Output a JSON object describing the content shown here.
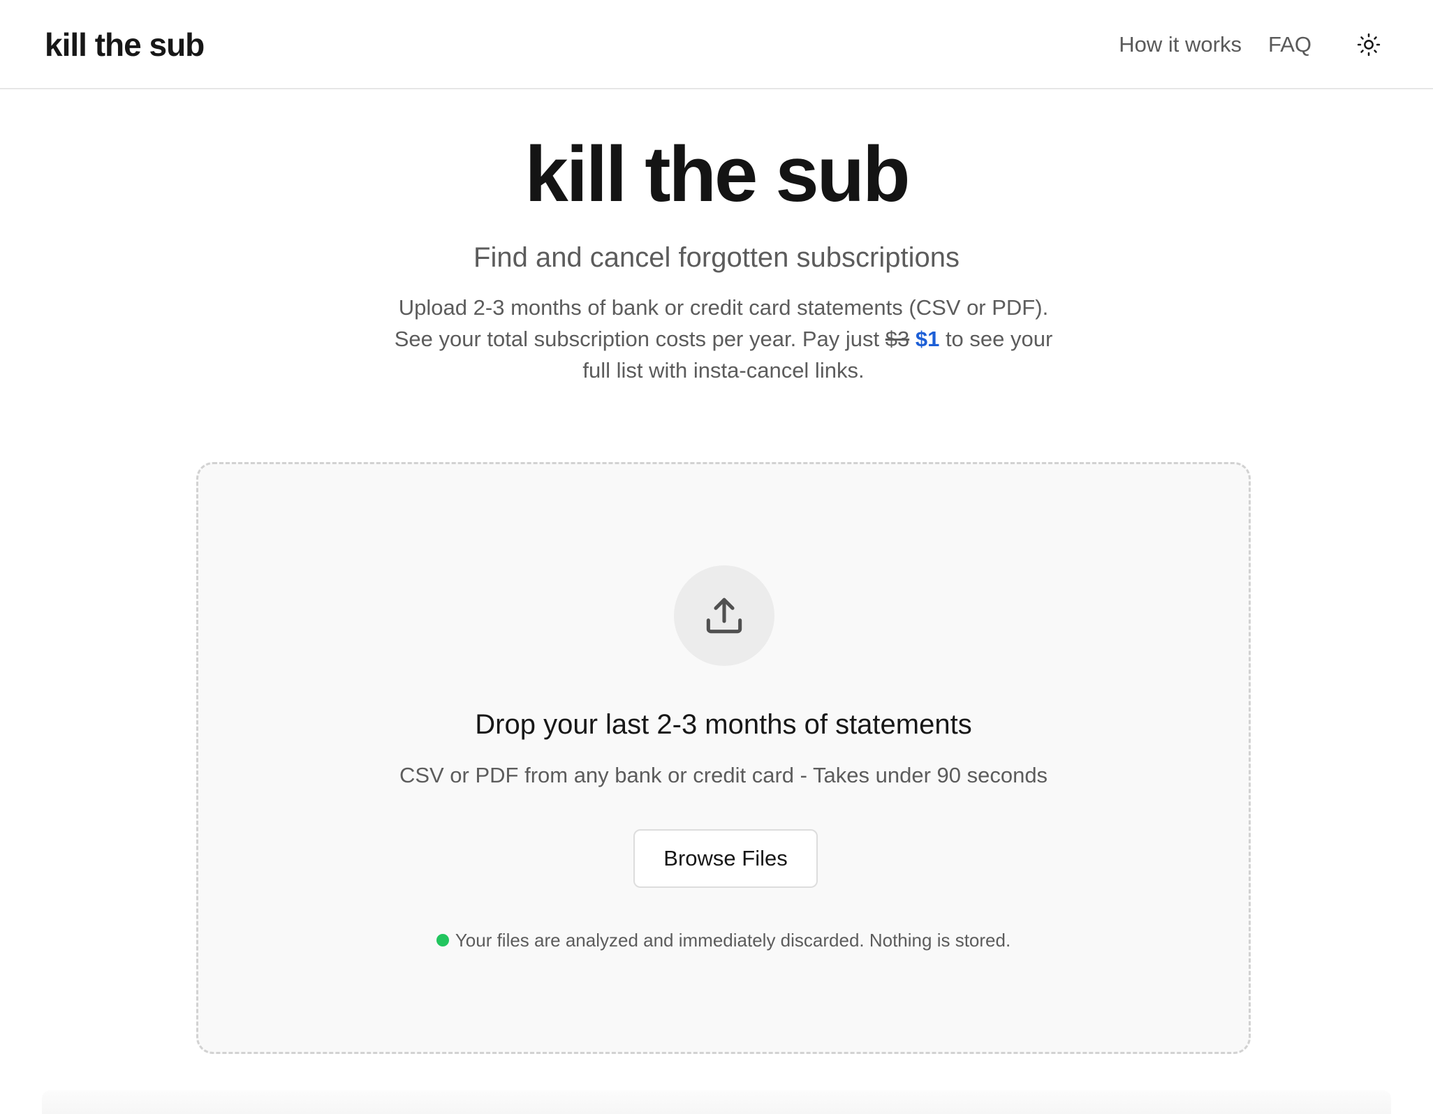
{
  "header": {
    "brand": "kill the sub",
    "nav": {
      "how_it_works": "How it works",
      "faq": "FAQ"
    },
    "theme_toggle_icon": "sun-icon"
  },
  "hero": {
    "title": "kill the sub",
    "subtitle": "Find and cancel forgotten subscriptions",
    "description_line1": "Upload 2-3 months of bank or credit card statements (CSV or PDF).",
    "description_line2_prefix": "See your total subscription costs per year. Pay just",
    "old_price": "$3",
    "new_price": "$1",
    "description_line2_suffix": "to see your",
    "description_line3": "full list with insta-cancel links."
  },
  "dropzone": {
    "icon": "upload-icon",
    "title": "Drop your last 2-3 months of statements",
    "description": "CSV or PDF from any bank or credit card - Takes under 90 seconds",
    "browse_label": "Browse Files",
    "privacy_note": "Your files are analyzed and immediately discarded. Nothing is stored."
  },
  "colors": {
    "accent_price": "#1d5fd6",
    "status_dot": "#22c55e",
    "dropzone_bg": "#f9f9f9",
    "dropzone_border": "#d2d2d2"
  }
}
